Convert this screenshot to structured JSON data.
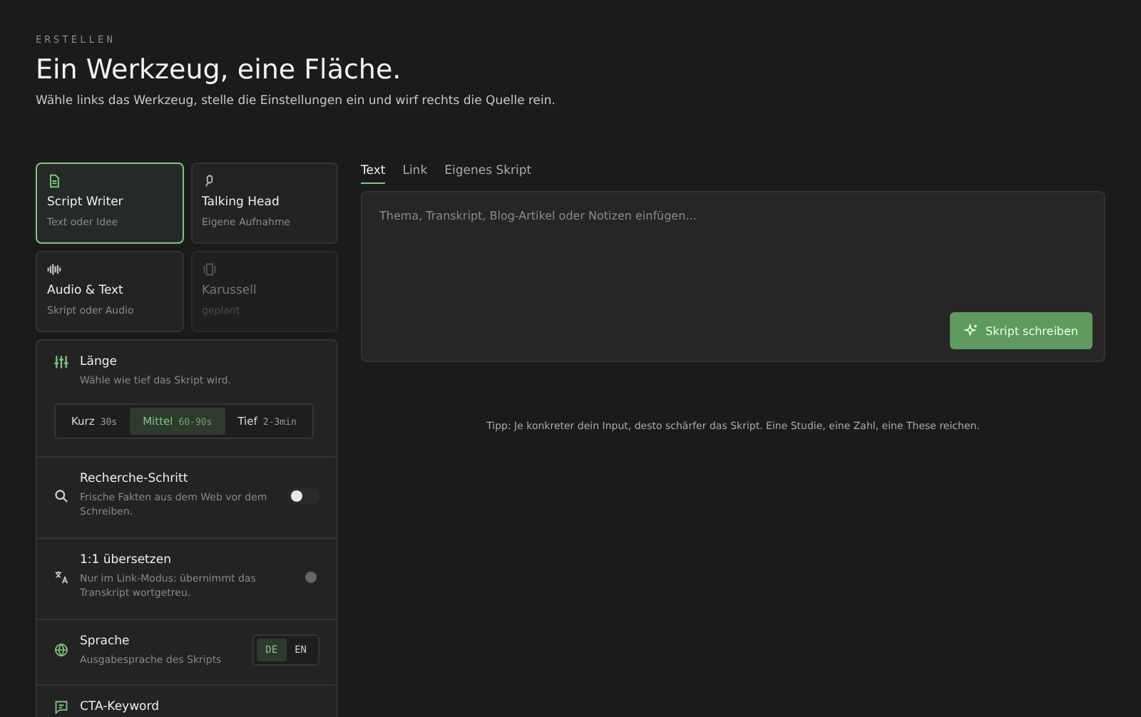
{
  "header": {
    "eyebrow": "ERSTELLEN",
    "title": "Ein Werkzeug, eine Fläche.",
    "subtitle": "Wähle links das Werkzeug, stelle die Einstellungen ein und wirf rechts die Quelle rein."
  },
  "tools": [
    {
      "kind": "doc",
      "title": "Script Writer",
      "subtitle": "Text oder Idee",
      "selected": true,
      "disabled": false
    },
    {
      "kind": "mic",
      "title": "Talking Head",
      "subtitle": "Eigene Aufnahme",
      "selected": false,
      "disabled": false
    },
    {
      "kind": "wave",
      "title": "Audio & Text",
      "subtitle": "Skript oder Audio",
      "selected": false,
      "disabled": false
    },
    {
      "kind": "cards",
      "title": "Karussell",
      "subtitle": "geplant",
      "selected": false,
      "disabled": true
    }
  ],
  "settings": [
    {
      "kind": "segments",
      "title": "Länge",
      "description": "Wähle wie tief das Skript wird.",
      "options": [
        {
          "label": "Kurz",
          "hint": "30s",
          "selected": false
        },
        {
          "label": "Mittel",
          "hint": "60-90s",
          "selected": true
        },
        {
          "label": "Tief",
          "hint": "2-3min",
          "selected": false
        }
      ]
    },
    {
      "kind": "toggle",
      "title": "Recherche-Schritt",
      "description": "Frische Fakten aus dem Web vor dem Schreiben.",
      "on": false,
      "disabled": false
    },
    {
      "kind": "toggle",
      "title": "1:1 übersetzen",
      "description": "Nur im Link-Modus: übernimmt das Transkript wortgetreu.",
      "disabled": true
    },
    {
      "kind": "language",
      "title": "Sprache",
      "description": "Ausgabesprache des Skripts",
      "options": [
        {
          "label": "DE",
          "selected": true
        },
        {
          "label": "EN",
          "selected": false
        }
      ]
    },
    {
      "kind": "plain",
      "title": "CTA-Keyword"
    }
  ],
  "tabs": [
    {
      "label": "Text",
      "selected": true
    },
    {
      "label": "Link",
      "selected": false
    },
    {
      "label": "Eigenes Skript",
      "selected": false
    }
  ],
  "input": {
    "placeholder": "Thema, Transkript, Blog-Artikel oder Notizen einfügen..."
  },
  "submit": {
    "label": "Skript schreiben"
  },
  "tip": "Tipp: Je konkreter dein Input, desto schärfer das Skript. Eine Studie, eine Zahl, eine These reichen."
}
